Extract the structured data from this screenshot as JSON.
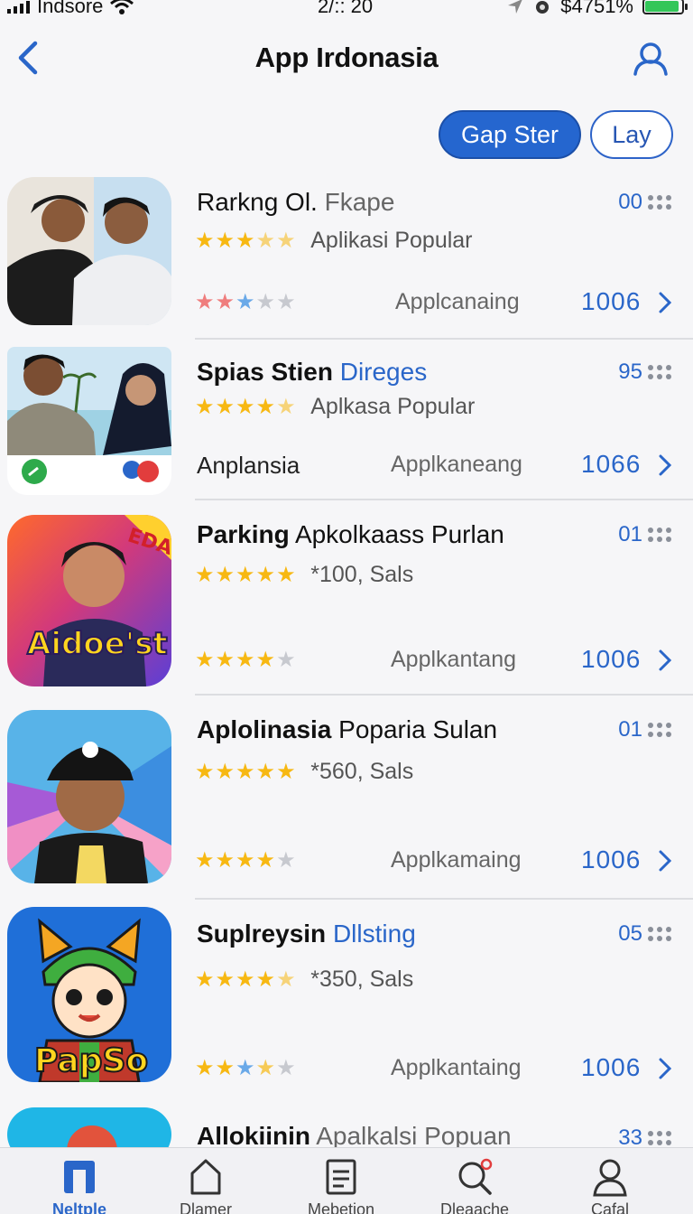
{
  "status_bar": {
    "carrier": "Indsore",
    "time": "2/:: 20",
    "battery": "$4751%",
    "battery_level": 0.92
  },
  "nav": {
    "title": "App Irdonasia",
    "back_icon": "chevron-left-icon",
    "user_icon": "user-icon"
  },
  "segments": {
    "active_label": "Gap Ster",
    "inactive_label": "Lay"
  },
  "apps": [
    {
      "title_bold": "Rarkng Ol.",
      "title_rest": "Fkape",
      "rank": "00",
      "rating_note": "Aplikasi Popular",
      "mid_label": "",
      "category": "Applcanaing",
      "count": "1006"
    },
    {
      "title_bold": "Spias Stien",
      "title_rest": "Direges",
      "rank": "95",
      "rating_note": "Aplkasa Popular",
      "mid_label": "Anplansia",
      "category": "Applkaneang",
      "count": "1066"
    },
    {
      "title_bold": "Parking",
      "title_rest": "Apkolkaass Purlan",
      "rank": "01",
      "rating_note": "*100, Sals",
      "mid_label": "",
      "category": "Applkantang",
      "count": "1006",
      "icon_text": "Aidoe'st",
      "icon_badge": "EDA"
    },
    {
      "title_bold": "Aplolinasia",
      "title_rest": "Poparia Sulan",
      "rank": "01",
      "rating_note": "*560, Sals",
      "mid_label": "",
      "category": "Applkamaing",
      "count": "1006"
    },
    {
      "title_bold": "Suplreysin",
      "title_rest": "Dllsting",
      "rank": "05",
      "rating_note": "*350, Sals",
      "mid_label": "",
      "category": "Applkantaing",
      "count": "1006",
      "icon_text": "PapSo"
    },
    {
      "title_bold": "Allokiinin",
      "title_rest": "Apalkalsi Popuan",
      "rank": "33"
    }
  ],
  "tabs": [
    {
      "label": "Neltple",
      "icon": "book-icon"
    },
    {
      "label": "Dlamer",
      "icon": "home-icon"
    },
    {
      "label": "Mebetion",
      "icon": "list-icon"
    },
    {
      "label": "Dleaache",
      "icon": "search-icon"
    },
    {
      "label": "Cafal",
      "icon": "person-icon"
    }
  ],
  "colors": {
    "accent": "#2a66c9",
    "star": "#f7b812",
    "battery": "#33c659"
  }
}
